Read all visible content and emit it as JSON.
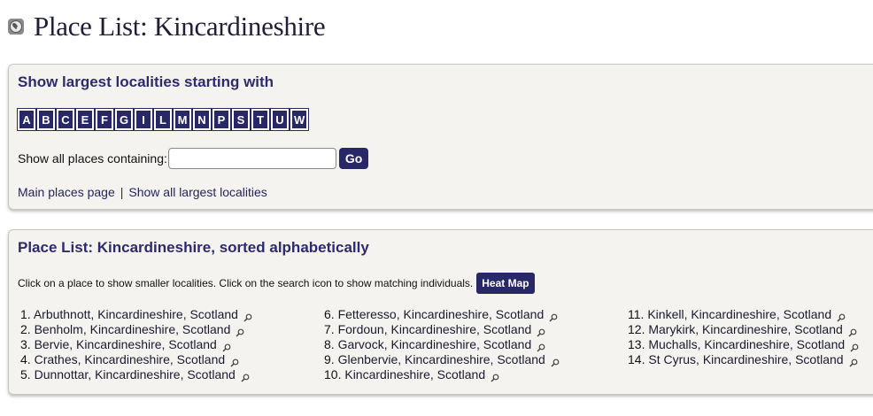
{
  "page": {
    "title": "Place List: Kincardineshire"
  },
  "letters_panel": {
    "heading": "Show largest localities starting with",
    "letters": [
      "A",
      "B",
      "C",
      "E",
      "F",
      "G",
      "I",
      "L",
      "M",
      "N",
      "P",
      "S",
      "T",
      "U",
      "W"
    ],
    "search_label": "Show all places containing:",
    "search_value": "",
    "search_placeholder": "",
    "go_label": "Go",
    "link_main": "Main places page",
    "separator": "|",
    "link_all": "Show all largest localities"
  },
  "list_panel": {
    "heading": "Place List: Kincardineshire, sorted alphabetically",
    "info": "Click on a place to show smaller localities. Click on the search icon to show matching individuals.",
    "heatmap_label": "Heat Map",
    "columns": [
      [
        {
          "num": "1.",
          "name": "Arbuthnott, Kincardineshire, Scotland"
        },
        {
          "num": "2.",
          "name": "Benholm, Kincardineshire, Scotland"
        },
        {
          "num": "3.",
          "name": "Bervie, Kincardineshire, Scotland"
        },
        {
          "num": "4.",
          "name": "Crathes, Kincardineshire, Scotland"
        },
        {
          "num": "5.",
          "name": "Dunnottar, Kincardineshire, Scotland"
        }
      ],
      [
        {
          "num": "6.",
          "name": "Fetteresso, Kincardineshire, Scotland"
        },
        {
          "num": "7.",
          "name": "Fordoun, Kincardineshire, Scotland"
        },
        {
          "num": "8.",
          "name": "Garvock, Kincardineshire, Scotland"
        },
        {
          "num": "9.",
          "name": "Glenbervie, Kincardineshire, Scotland"
        },
        {
          "num": "10.",
          "name": "Kincardineshire, Scotland"
        }
      ],
      [
        {
          "num": "11.",
          "name": "Kinkell, Kincardineshire, Scotland"
        },
        {
          "num": "12.",
          "name": "Marykirk, Kincardineshire, Scotland"
        },
        {
          "num": "13.",
          "name": "Muchalls, Kincardineshire, Scotland"
        },
        {
          "num": "14.",
          "name": "St Cyrus, Kincardineshire, Scotland"
        }
      ]
    ]
  },
  "colors": {
    "accent": "#282868",
    "heading": "#2d2a6e",
    "panel_bg": "#f5f3f0"
  }
}
